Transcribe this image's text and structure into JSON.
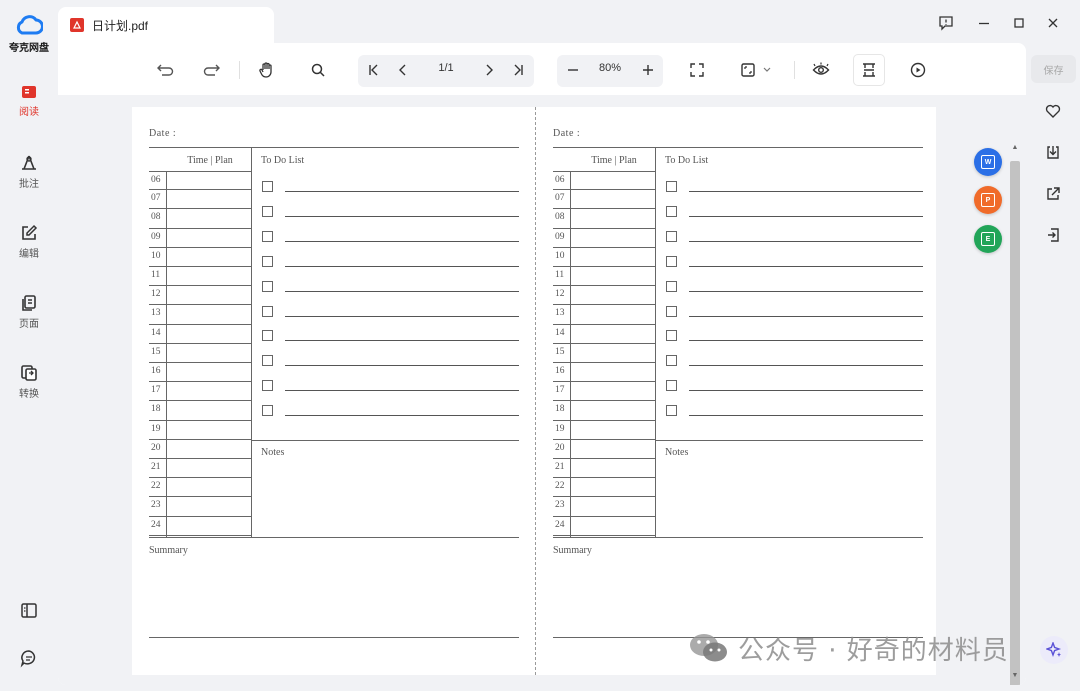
{
  "app": {
    "name": "夸克网盘",
    "brand_color": "#1e7cf2",
    "accent_color": "#e0352b"
  },
  "left_rail": {
    "items": [
      {
        "label": "阅读",
        "icon": "read-icon",
        "active": true
      },
      {
        "label": "批注",
        "icon": "annotate-icon",
        "active": false
      },
      {
        "label": "编辑",
        "icon": "edit-icon",
        "active": false
      },
      {
        "label": "页面",
        "icon": "pages-icon",
        "active": false
      },
      {
        "label": "转换",
        "icon": "convert-icon",
        "active": false
      }
    ],
    "bottom": [
      "sidebar-toggle-icon",
      "chat-icon"
    ]
  },
  "tab": {
    "title": "日计划.pdf",
    "icon": "pdf-icon"
  },
  "window_controls": [
    "feedback-icon",
    "minimize-icon",
    "maximize-icon",
    "close-icon"
  ],
  "toolbar": {
    "page_indicator": "1/1",
    "zoom": "80%",
    "tools": [
      "undo-icon",
      "redo-icon",
      "hand-icon",
      "search-icon",
      "first-page-icon",
      "prev-page-icon",
      "next-page-icon",
      "last-page-icon",
      "zoom-out-icon",
      "zoom-in-icon",
      "fullscreen-icon",
      "fit-page-icon",
      "eye-care-icon",
      "split-view-icon",
      "play-icon"
    ]
  },
  "planner": {
    "date_label": "Date :",
    "time_plan_header": "Time | Plan",
    "todo_header": "To Do List",
    "notes_label": "Notes",
    "summary_label": "Summary",
    "hours": [
      "06",
      "07",
      "08",
      "09",
      "10",
      "11",
      "12",
      "13",
      "14",
      "15",
      "16",
      "17",
      "18",
      "19",
      "20",
      "21",
      "22",
      "23",
      "24"
    ],
    "todo_count": 10
  },
  "float_actions": [
    {
      "icon": "to-word-icon",
      "color": "#2b6fe6",
      "glyph": "W"
    },
    {
      "icon": "to-ppt-icon",
      "color": "#f06b2a",
      "glyph": "P"
    },
    {
      "icon": "to-excel-icon",
      "color": "#22a559",
      "glyph": "E"
    }
  ],
  "right_rail": {
    "save_label": "保存",
    "icons": [
      "favorite-icon",
      "download-icon",
      "share-icon",
      "export-icon"
    ]
  },
  "watermark": {
    "text": "公众号 · 好奇的材料员"
  }
}
